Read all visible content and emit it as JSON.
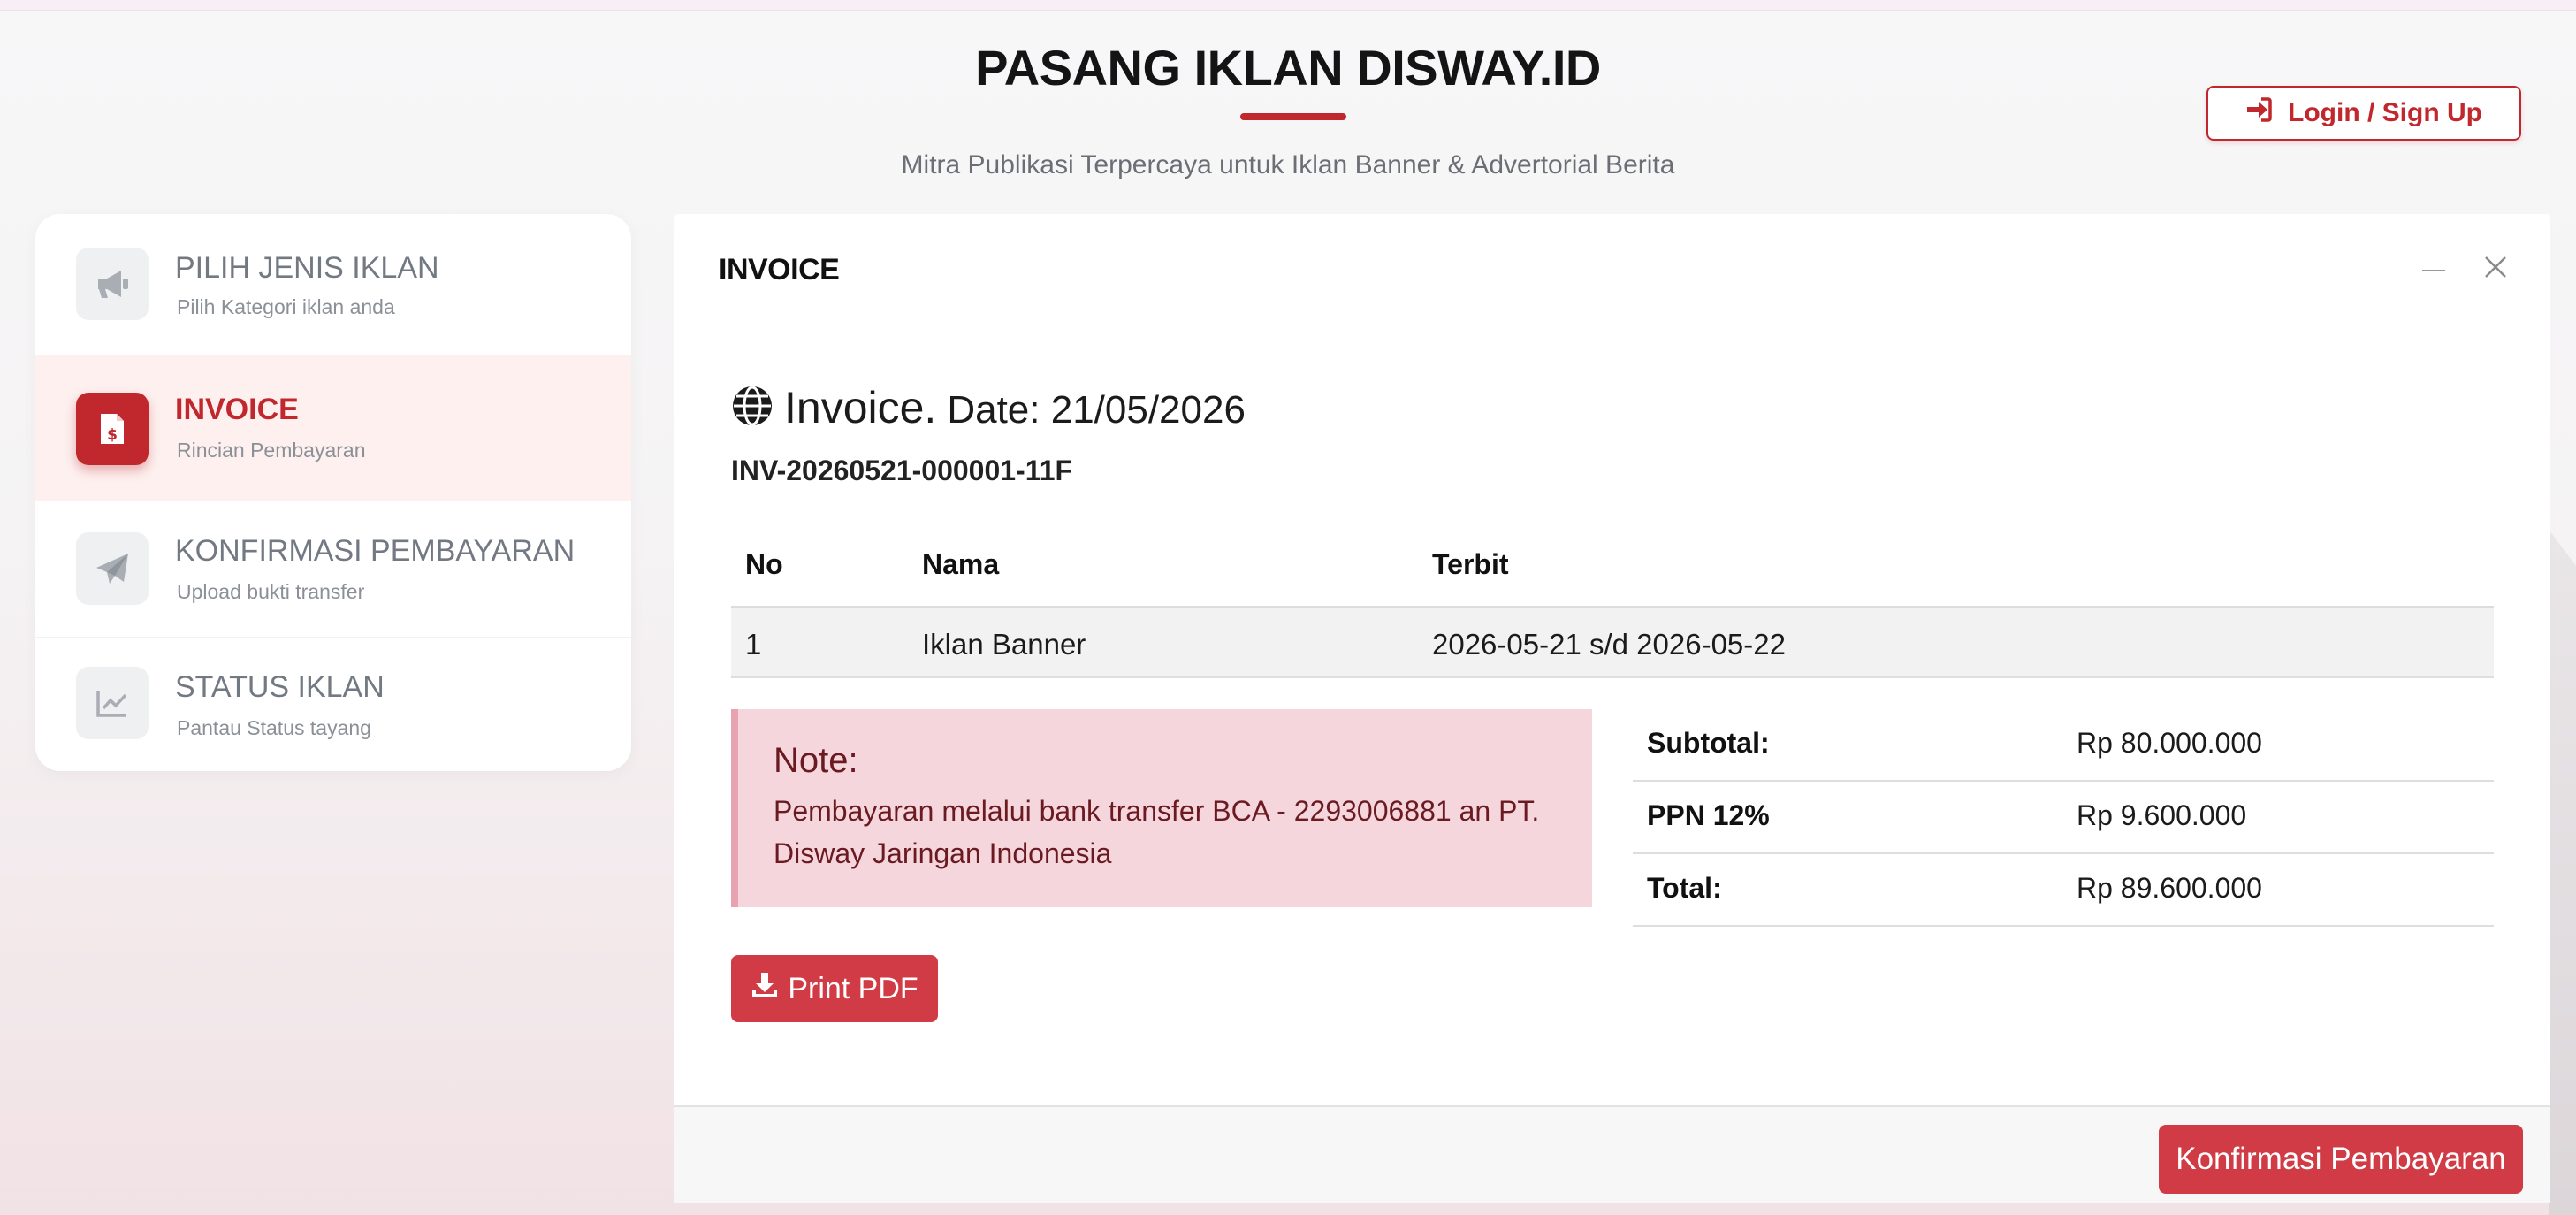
{
  "header": {
    "title": "PASANG IKLAN DISWAY.ID",
    "subtitle": "Mitra Publikasi Terpercaya untuk Iklan Banner & Advertorial Berita",
    "login_label": "Login / Sign Up"
  },
  "steps": [
    {
      "label": "PILIH JENIS IKLAN",
      "sub": "Pilih Kategori iklan anda",
      "icon": "megaphone-icon"
    },
    {
      "label": "INVOICE",
      "sub": "Rincian Pembayaran",
      "icon": "invoice-icon",
      "active": true
    },
    {
      "label": "KONFIRMASI PEMBAYARAN",
      "sub": "Upload bukti transfer",
      "icon": "paper-plane-icon"
    },
    {
      "label": "STATUS IKLAN",
      "sub": "Pantau Status tayang",
      "icon": "chart-line-icon"
    }
  ],
  "modal": {
    "title": "INVOICE",
    "invoice_word": "Invoice.",
    "date_text": "Date: 21/05/2026",
    "invoice_number": "INV-20260521-000001-11F",
    "table": {
      "headers": [
        "No",
        "Nama",
        "Terbit"
      ],
      "rows": [
        [
          "1",
          "Iklan Banner",
          "2026-05-21 s/d 2026-05-22"
        ]
      ]
    },
    "note": {
      "title": "Note:",
      "text": "Pembayaran melalui bank transfer BCA - 2293006881 an PT. Disway Jaringan Indonesia"
    },
    "totals": [
      {
        "label": "Subtotal:",
        "value": "Rp 80.000.000"
      },
      {
        "label": "PPN 12%",
        "value": "Rp 9.600.000"
      },
      {
        "label": "Total:",
        "value": "Rp 89.600.000"
      }
    ],
    "print_label": "Print PDF",
    "confirm_label": "Konfirmasi Pembayaran"
  },
  "colors": {
    "accent": "#c0282d",
    "button": "#d13b45",
    "note_bg": "#f4d6dc"
  }
}
